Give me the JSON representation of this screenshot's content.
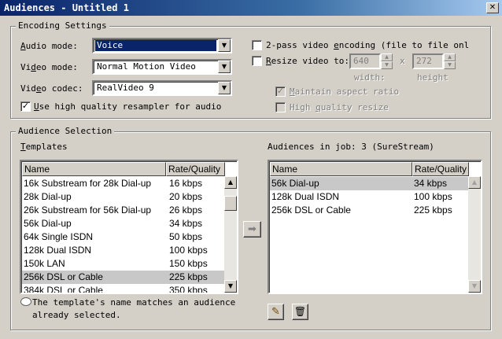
{
  "window": {
    "title": "Audiences - Untitled 1",
    "close_glyph": "✕"
  },
  "encoding": {
    "legend": "Encoding Settings",
    "audio_mode": {
      "label_u": "A",
      "label_rest": "udio mode:",
      "value": "Voice"
    },
    "video_mode": {
      "label_pre": "Vi",
      "label_u": "d",
      "label_rest": "eo mode:",
      "value": "Normal Motion Video"
    },
    "video_codec": {
      "label_pre": "Vid",
      "label_u": "e",
      "label_rest": "o codec:",
      "value": "RealVideo 9"
    },
    "high_quality_resampler": {
      "checked": true,
      "label_u": "U",
      "label_rest": "se high quality resampler for audio"
    },
    "two_pass": {
      "checked": false,
      "label": "2-pass video ",
      "label_u": "e",
      "label_rest": "ncoding (file to file onl"
    },
    "resize": {
      "checked": false,
      "label_u": "R",
      "label_rest": "esize video to:",
      "width_value": "640",
      "height_value": "272",
      "times": "x",
      "width_label": "width:",
      "height_label": "height"
    },
    "maintain_aspect": {
      "checked": true,
      "label_u": "M",
      "label_rest": "aintain aspect ratio"
    },
    "high_quality_resize": {
      "checked": false,
      "label_pre": "High ",
      "label_u": "q",
      "label_rest": "uality resize"
    }
  },
  "audience": {
    "legend": "Audience Selection",
    "templates_label_u": "T",
    "templates_label_rest": "emplates",
    "jobs_label": "Audiences in job: 3  (SureStream)",
    "columns": [
      "Name",
      "Rate/Quality"
    ],
    "templates": [
      {
        "name": "16k Substream for 28k Dial-up",
        "rate": "16 kbps"
      },
      {
        "name": "28k Dial-up",
        "rate": "20 kbps"
      },
      {
        "name": "26k Substream for 56k Dial-up",
        "rate": "26 kbps"
      },
      {
        "name": "56k Dial-up",
        "rate": "34 kbps"
      },
      {
        "name": "64k Single ISDN",
        "rate": "50 kbps"
      },
      {
        "name": "128k Dual ISDN",
        "rate": "100 kbps"
      },
      {
        "name": "150k LAN",
        "rate": "150 kbps"
      },
      {
        "name": "256k DSL or Cable",
        "rate": "225 kbps"
      },
      {
        "name": "384k DSL or Cable",
        "rate": "350 kbps"
      }
    ],
    "jobs": [
      {
        "name": "56k Dial-up",
        "rate": "34 kbps"
      },
      {
        "name": "128k Dual ISDN",
        "rate": "100 kbps"
      },
      {
        "name": "256k DSL or Cable",
        "rate": "225 kbps"
      }
    ],
    "note_line1": "The template's name matches an audience",
    "note_line2": "already selected.",
    "add_glyph": "➡",
    "edit_glyph": "✎",
    "delete_glyph": "🗑",
    "scroll_up_glyph": "▲",
    "scroll_down_glyph": "▼",
    "combo_glyph": "▼",
    "spin_up_glyph": "▲",
    "spin_down_glyph": "▼",
    "check_glyph": "✓"
  }
}
